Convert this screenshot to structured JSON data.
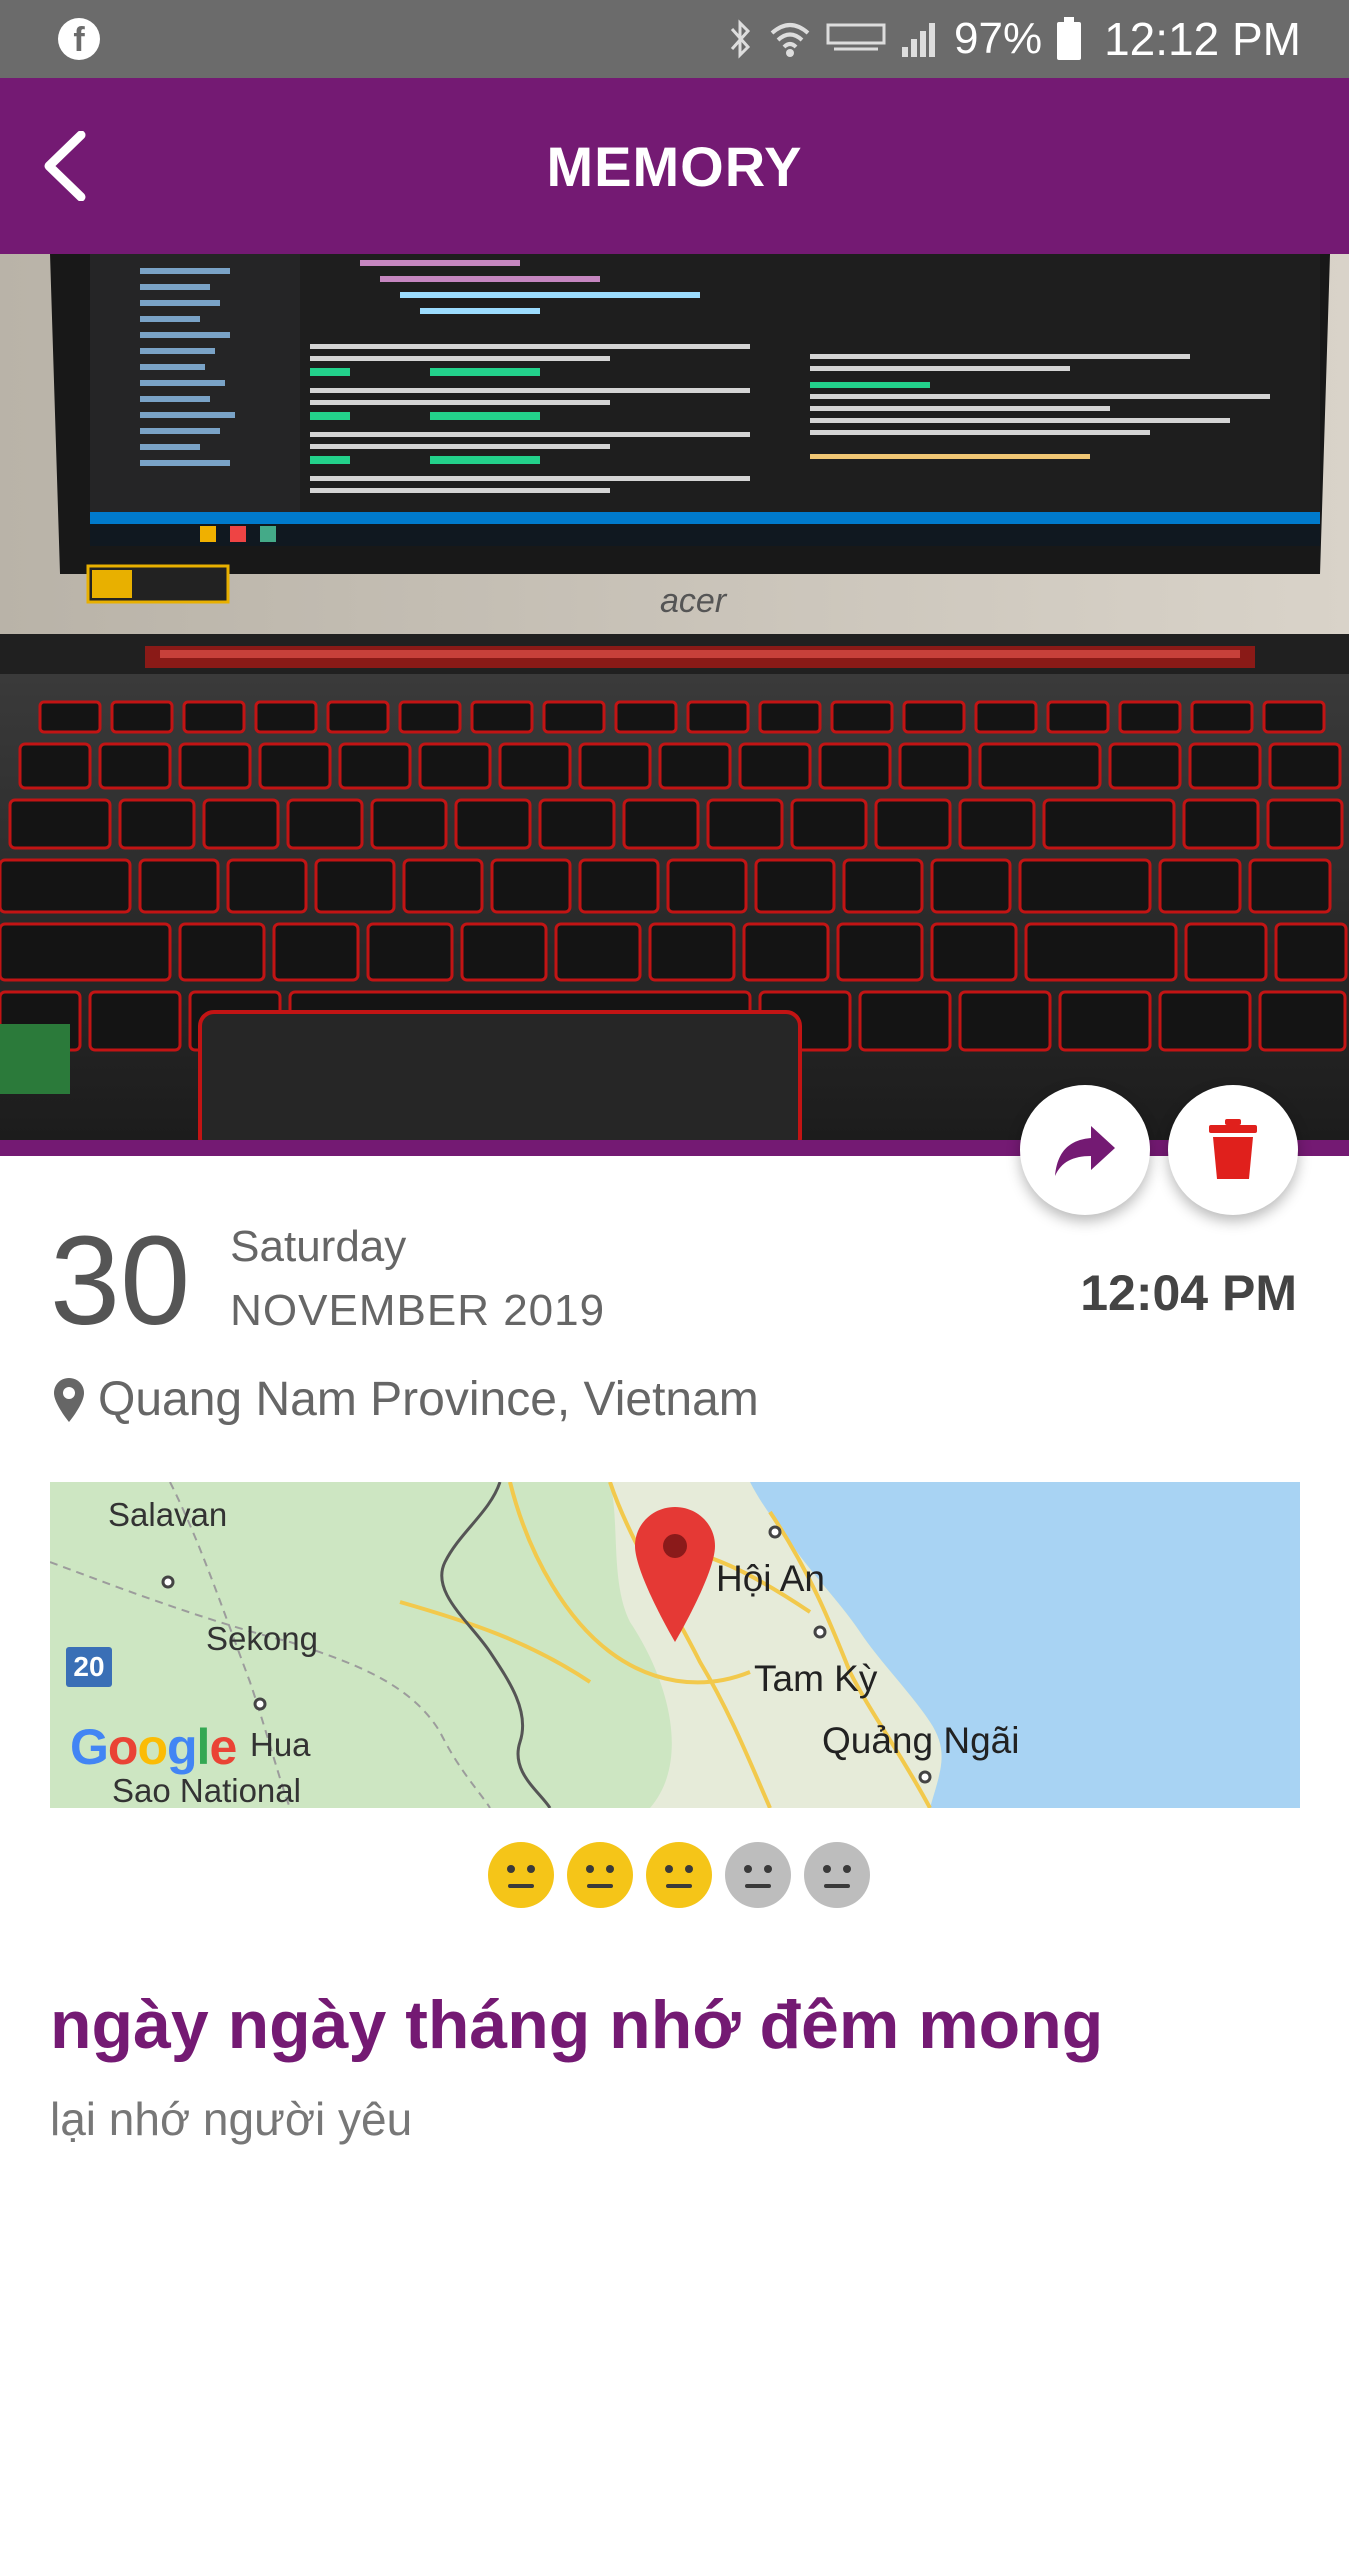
{
  "status_bar": {
    "battery": "97%",
    "time": "12:12 PM",
    "icons": [
      "facebook-icon",
      "bluetooth-icon",
      "wifi-icon",
      "volte-icon",
      "signal-icon",
      "battery-icon"
    ]
  },
  "app_bar": {
    "title": "MEMORY",
    "back_icon": "chevron-left-icon"
  },
  "photo": {
    "description_icon": "laptop-photo"
  },
  "actions": {
    "share_icon": "share-icon",
    "delete_icon": "trash-icon",
    "share_color": "#741a73",
    "delete_color": "#e0201c"
  },
  "date": {
    "day": "30",
    "weekday": "Saturday",
    "month_year": "NOVEMBER 2019",
    "time": "12:04 PM"
  },
  "location": {
    "icon": "map-pin-icon",
    "text": "Quang Nam Province, Vietnam"
  },
  "map": {
    "labels": {
      "salavan": "Salavan",
      "sekong": "Sekong",
      "hoi_an": "Hội An",
      "tam_ky": "Tam Kỳ",
      "quang_ngai": "Quảng Ngãi",
      "hua": "Hua",
      "sao_national": "Sao National"
    },
    "route_badge": "20",
    "attribution": "Google"
  },
  "moods": {
    "rating": 3,
    "max": 5,
    "active_color": "#f5c518",
    "inactive_color": "#bdbdbd"
  },
  "memory": {
    "title": "ngày ngày tháng nhớ đêm mong",
    "body": "lại nhớ người yêu"
  },
  "colors": {
    "brand": "#741a73",
    "status_bar": "#6b6b6b"
  }
}
